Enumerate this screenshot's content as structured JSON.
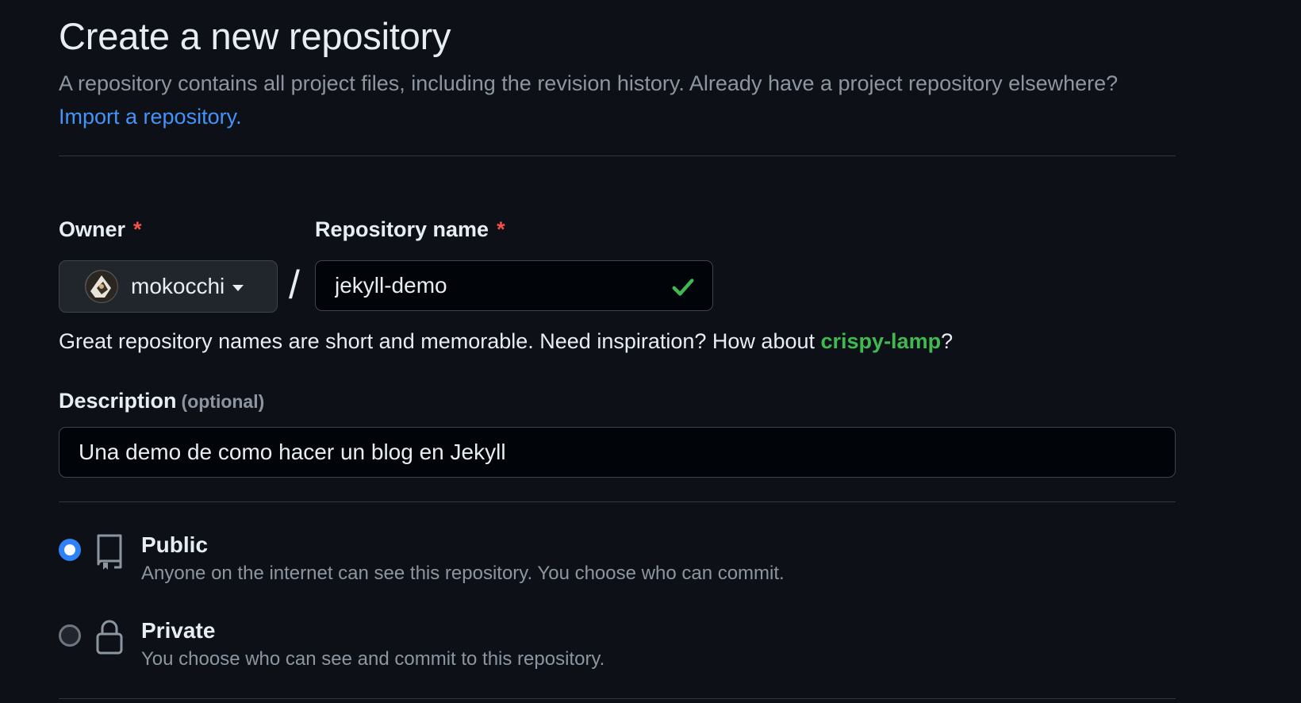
{
  "header": {
    "title": "Create a new repository",
    "subtitle": "A repository contains all project files, including the revision history. Already have a project repository elsewhere?",
    "import_link": "Import a repository."
  },
  "owner": {
    "label": "Owner",
    "required_mark": "*",
    "value": "mokocchi",
    "icon": "caret-down-icon"
  },
  "separator": "/",
  "repo_name": {
    "label": "Repository name",
    "required_mark": "*",
    "value": "jekyll-demo",
    "valid_icon": "check-icon",
    "valid_color": "#3fb950"
  },
  "name_hint": {
    "text": "Great repository names are short and memorable. Need inspiration? How about",
    "suggestion": "crispy-lamp",
    "suffix": "?"
  },
  "description": {
    "label": "Description",
    "optional": "(optional)",
    "value": "Una demo de como hacer un blog en Jekyll"
  },
  "visibility": {
    "options": [
      {
        "title": "Public",
        "description": "Anyone on the internet can see this repository. You choose who can commit.",
        "icon": "repo-icon",
        "selected": true
      },
      {
        "title": "Private",
        "description": "You choose who can see and commit to this repository.",
        "icon": "lock-icon",
        "selected": false
      }
    ]
  },
  "colors": {
    "background": "#0d1117",
    "link": "#4493f8",
    "required": "#f85149",
    "success": "#3fb950",
    "radio_selected": "#2f81f7"
  }
}
